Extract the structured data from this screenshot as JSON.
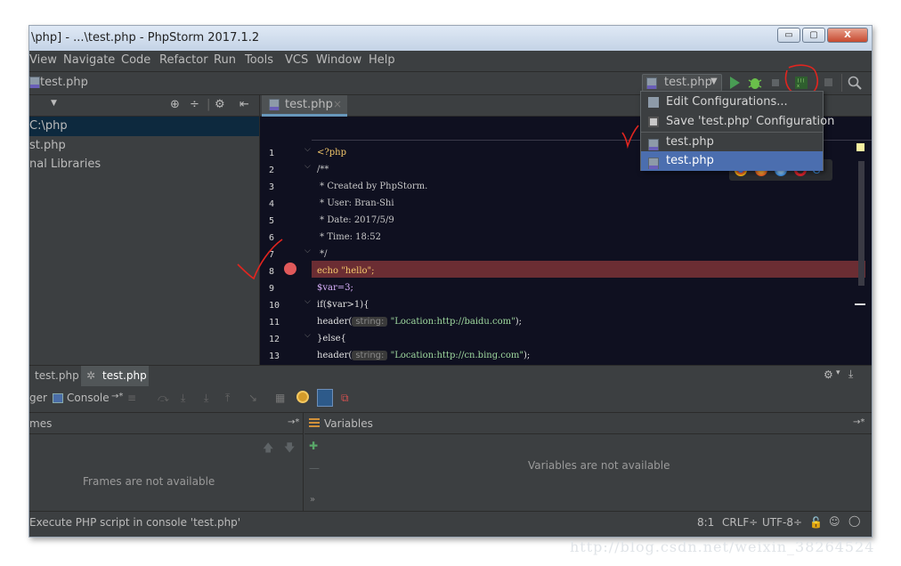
{
  "window": {
    "title": "\\php] - ...\\test.php - PhpStorm 2017.1.2",
    "controls": {
      "minimize": "▭",
      "maximize": "▢",
      "close": "X"
    }
  },
  "menu": [
    "View",
    "Navigate",
    "Code",
    "Refactor",
    "Run",
    "Tools",
    "VCS",
    "Window",
    "Help"
  ],
  "navbar": {
    "file": "test.php",
    "run_config": "test.php"
  },
  "run_dropdown": {
    "items": [
      "Edit Configurations...",
      "Save 'test.php' Configuration",
      "test.php",
      "test.php"
    ],
    "selected_index": 3
  },
  "project_tree": {
    "items": [
      "C:\\php",
      "st.php",
      "nal Libraries"
    ]
  },
  "editor": {
    "tab": "test.php",
    "lines": [
      {
        "n": "1",
        "text": "<?php"
      },
      {
        "n": "2",
        "text": "/**"
      },
      {
        "n": "3",
        "text": " * Created by PhpStorm."
      },
      {
        "n": "4",
        "text": " * User: Bran-Shi"
      },
      {
        "n": "5",
        "text": " * Date: 2017/5/9"
      },
      {
        "n": "6",
        "text": " * Time: 18:52"
      },
      {
        "n": "7",
        "text": " */"
      },
      {
        "n": "8",
        "text": "echo \"hello\";",
        "breakpoint": true
      },
      {
        "n": "9",
        "text": "$var=3;"
      },
      {
        "n": "10",
        "text": "if($var>1){"
      },
      {
        "n": "11",
        "hint": "string:",
        "pre": "header(",
        "str": "\"Location:http://baidu.com\"",
        "post": ");"
      },
      {
        "n": "12",
        "text": "}else{"
      },
      {
        "n": "13",
        "hint": "string:",
        "pre": "header(",
        "str": "\"Location:http://cn.bing.com\"",
        "post": ");"
      }
    ]
  },
  "bottom_tabs": [
    "test.php",
    "test.php"
  ],
  "debug_toolbar": {
    "debugger_tab": "ger",
    "console_tab": "Console",
    "console_pin": "→*"
  },
  "frames_panel": {
    "title": "mes",
    "pin": "→*",
    "empty_text": "Frames are not available"
  },
  "variables_panel": {
    "title": "Variables",
    "pin": "→*",
    "empty_text": "Variables are not available"
  },
  "statusbar": {
    "message": "Execute PHP script in console 'test.php'",
    "position": "8:1",
    "line_sep": "CRLF÷",
    "encoding": "UTF-8÷"
  },
  "watermark": "http://blog.csdn.net/weixin_38264524",
  "colors": {
    "accent": "#4b6eaf",
    "breakpoint_line": "#6b2d33",
    "breakpoint_dot": "#e0595a",
    "annotation": "#e2251f"
  }
}
